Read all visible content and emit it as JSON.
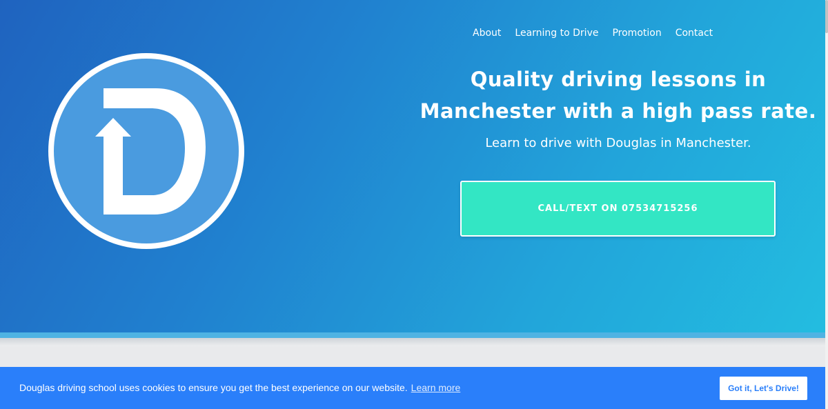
{
  "nav": {
    "items": [
      {
        "label": "About"
      },
      {
        "label": "Learning to Drive"
      },
      {
        "label": "Promotion"
      },
      {
        "label": "Contact"
      }
    ]
  },
  "hero": {
    "logo_icon": "d-with-up-arrow-logo",
    "headline_line1": "Quality driving lessons in",
    "headline_line2": "Manchester with a high pass rate.",
    "subhead": "Learn to drive with Douglas in Manchester.",
    "cta_label": "CALL/TEXT ON 07534715256"
  },
  "cookie": {
    "message": "Douglas driving school uses cookies to ensure you get the best experience on our website.",
    "learn_more": "Learn more",
    "accept_label": "Got it, Let's Drive!"
  },
  "colors": {
    "hero_gradient_start": "#1f63bf",
    "hero_gradient_end": "#23bde0",
    "cta_background": "#33e6c4",
    "cookie_bar": "#2a7ffa",
    "logo_fill": "#4a9bdf"
  }
}
